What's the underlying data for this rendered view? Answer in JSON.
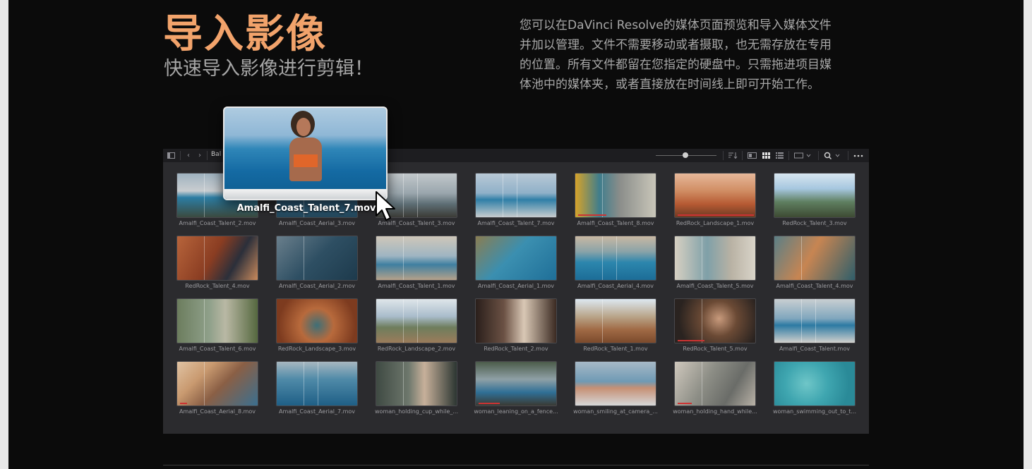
{
  "header": {
    "title": "导入影像",
    "subtitle": "快速导入影像进行剪辑！",
    "description": "您可以在DaVinci Resolve的媒体页面预览和导入媒体文件并加以管理。文件不需要移动或者摄取，也无需存放在专用的位置。所有文件都留在您指定的硬盘中。只需拖进项目媒体池中的媒体夹，或者直接放在时间线上即可开始工作。"
  },
  "colors": {
    "title": "#f2a36b",
    "page_bg": "#0b0b0b",
    "panel_bg": "#2b2b2e",
    "toolbar_bg": "#1d1d20",
    "clip_bar": "#cc3333"
  },
  "toolbar": {
    "bin_name": "Bal",
    "icons": [
      "sidebar-toggle-icon",
      "back-arrow-icon",
      "forward-arrow-icon",
      "sort-icon",
      "metadata-view-icon",
      "thumbnail-view-icon",
      "list-view-icon",
      "clip-size-icon",
      "search-icon",
      "more-options-icon"
    ]
  },
  "drag": {
    "clip_name": "Amalfi_Coast_Talent_7.mov",
    "icon": "mouse-pointer-icon"
  },
  "clips": [
    {
      "name": "Amalfi_Coast_Talent_2.mov",
      "bg": "linear-gradient(#9fb2bf 0%,#c9cdd0 40%,#2c7da3 55%,#3b4a3f 100%)",
      "bar": 0,
      "lines": 1
    },
    {
      "name": "Amalfi_Coast_Aerial_3.mov",
      "bg": "linear-gradient(#6f8da3,#2f5f7e 60%,#24485c)",
      "bar": 0,
      "lines": 1
    },
    {
      "name": "Amalfi_Coast_Talent_3.mov",
      "bg": "linear-gradient(#c2c8cb 0%,#9aa6ad 45%,#5d6d74 70%,#3b3b36 100%)",
      "bar": 0,
      "lines": 2
    },
    {
      "name": "Amalfi_Coast_Talent_7.mov",
      "bg": "linear-gradient(#b9c9d6 0%,#8fb0c8 45%,#2f7fa7 60%,#c7ccce 100%)",
      "bar": 0,
      "lines": 2
    },
    {
      "name": "Amalfi_Coast_Talent_8.mov",
      "bg": "linear-gradient(90deg,#d6a32a 0%,#3f7d8c 30%,#8a8d8a 55%,#c9c6b9 100%)",
      "bar": 40,
      "lines": 1
    },
    {
      "name": "RedRock_Landscape_1.mov",
      "bg": "linear-gradient(#e6b89a 0%,#d08d63 40%,#b65a33 70%,#6d3a24 100%)",
      "bar": 108,
      "lines": 0
    },
    {
      "name": "RedRock_Talent_3.mov",
      "bg": "linear-gradient(#d8e6f0 0%,#a6c7df 35%,#5f7f60 65%,#3d4a33 100%)",
      "bar": 0,
      "lines": 0
    },
    {
      "name": "RedRock_Talent_4.mov",
      "bg": "linear-gradient(120deg,#b7643b 0%,#8a3d22 45%,#2b2f3a 70%,#c98a5c 100%)",
      "bar": 0,
      "lines": 1
    },
    {
      "name": "Amalfi_Coast_Aerial_2.mov",
      "bg": "linear-gradient(135deg,#6a7f8c 0%,#2e4f63 50%,#1d3a4c 100%)",
      "bar": 0,
      "lines": 1
    },
    {
      "name": "Amalfi_Coast_Talent_1.mov",
      "bg": "linear-gradient(#cfc7b9 0%,#9fb5c2 45%,#3f7fa0 65%,#b5a18a 100%)",
      "bar": 0,
      "lines": 1
    },
    {
      "name": "Amalfi_Coast_Aerial_1.mov",
      "bg": "linear-gradient(135deg,#8a7d52 0%,#3b8fb0 45%,#1f6f98 100%)",
      "bar": 0,
      "lines": 0
    },
    {
      "name": "Amalfi_Coast_Aerial_4.mov",
      "bg": "linear-gradient(#c9b9a3 0%,#8aa3a8 35%,#2c86ad 60%,#1c6d97 100%)",
      "bar": 0,
      "lines": 2
    },
    {
      "name": "Amalfi_Coast_Talent_5.mov",
      "bg": "linear-gradient(90deg,#d7d0c2 0%,#7fa0a8 40%,#b9b2a4 70%,#d9d4c9 100%)",
      "bar": 0,
      "lines": 1
    },
    {
      "name": "Amalfi_Coast_Talent_4.mov",
      "bg": "linear-gradient(120deg,#5b7f86 0%,#c78552 45%,#2f5e6a 100%)",
      "bar": 0,
      "lines": 1
    },
    {
      "name": "Amalfi_Coast_Talent_6.mov",
      "bg": "linear-gradient(90deg,#6c7d5e 0%,#8fa08a 40%,#b9b8a4 60%,#55683f 100%)",
      "bar": 0,
      "lines": 1
    },
    {
      "name": "RedRock_Landscape_3.mov",
      "bg": "radial-gradient(circle at 50% 60%,#3e6f77 0%,#b86a3c 35%,#7d3b1f 80%)",
      "bar": 0,
      "lines": 0
    },
    {
      "name": "RedRock_Landscape_2.mov",
      "bg": "linear-gradient(#dfe6ea 0%,#a9bccb 40%,#6e7d5c 65%,#9b7c5b 100%)",
      "bar": 0,
      "lines": 2
    },
    {
      "name": "RedRock_Talent_2.mov",
      "bg": "linear-gradient(90deg,#2a1f1b 0%,#6b5144 35%,#d9c8b5 60%,#3b2a22 100%)",
      "bar": 0,
      "lines": 0
    },
    {
      "name": "RedRock_Talent_1.mov",
      "bg": "linear-gradient(#dde8f1 0%,#b9a58a 40%,#a06a45 70%,#7b4a2c 100%)",
      "bar": 0,
      "lines": 1
    },
    {
      "name": "RedRock_Talent_5.mov",
      "bg": "radial-gradient(circle at 55% 45%,#c89a7c 0%,#6b4a35 35%,#2a2320 80%)",
      "bar": 38,
      "lines": 1
    },
    {
      "name": "Amalfi_Coast_Talent.mov",
      "bg": "linear-gradient(#c9cfd2 0%,#7fa6bd 45%,#2c7aa3 60%,#d2d0cc 100%)",
      "bar": 0,
      "lines": 2
    },
    {
      "name": "Amalfi_Coast_Aerial_8.mov",
      "bg": "linear-gradient(135deg,#e0c3a3 0%,#c99a70 30%,#8a5f45 55%,#3b6f8f 100%)",
      "bar": 10,
      "lines": 1
    },
    {
      "name": "Amalfi_Coast_Aerial_7.mov",
      "bg": "linear-gradient(#a7b7c0 0%,#4f8aa8 40%,#1f5f86 100%)",
      "bar": 0,
      "lines": 2
    },
    {
      "name": "woman_holding_cup_while_...",
      "bg": "linear-gradient(90deg,#3f4a43 0%,#6d776c 40%,#c7b09a 60%,#2c3632 100%)",
      "bar": 0,
      "lines": 1
    },
    {
      "name": "woman_leaning_on_a_fence...",
      "bg": "linear-gradient(#4c5c4a 0%,#8fa0a6 40%,#2f6f96 70%,#3a3a33 100%)",
      "bar": 30,
      "lines": 0
    },
    {
      "name": "woman_smiling_at_camera_...",
      "bg": "linear-gradient(#a7b9c7 0%,#6f9ab4 45%,#c69074 60%,#d5d7d8 100%)",
      "bar": 0,
      "lines": 0
    },
    {
      "name": "woman_holding_hand_while...",
      "bg": "linear-gradient(120deg,#cfc8bd 0%,#8d8e86 40%,#6a6c68 70%,#b8b1a6 100%)",
      "bar": 20,
      "lines": 1
    },
    {
      "name": "woman_swimming_out_to_t...",
      "bg": "radial-gradient(circle at 40% 50%,#6fc6c8 0%,#3fa6b0 40%,#2a8a98 80%)",
      "bar": 0,
      "lines": 0
    }
  ]
}
